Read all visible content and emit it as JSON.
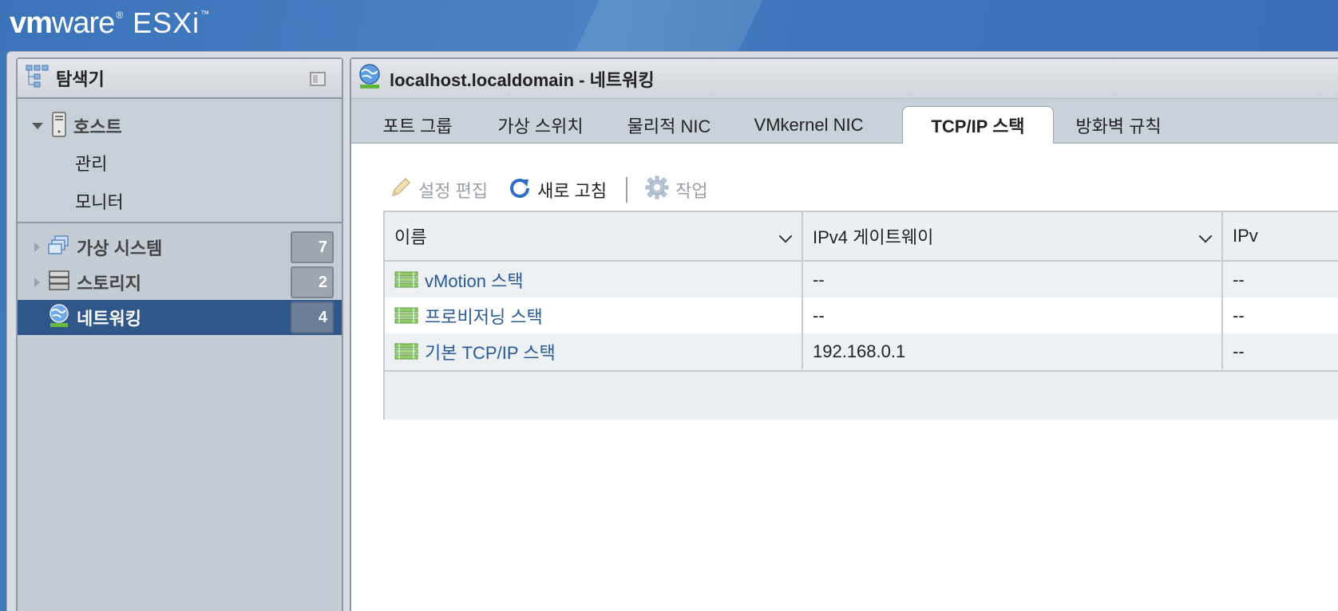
{
  "brand": {
    "vm": "vm",
    "ware": "ware",
    "reg": "®",
    "esxi": "ESXi",
    "tm": "™"
  },
  "navigator": {
    "title": "탐색기",
    "host": {
      "label": "호스트",
      "children": [
        "관리",
        "모니터"
      ]
    },
    "items": [
      {
        "label": "가상 시스템",
        "count": "7"
      },
      {
        "label": "스토리지",
        "count": "2"
      },
      {
        "label": "네트워킹",
        "count": "4",
        "selected": true
      }
    ]
  },
  "main": {
    "title": "localhost.localdomain - 네트워킹",
    "tabs": [
      {
        "label": "포트 그룹"
      },
      {
        "label": "가상 스위치"
      },
      {
        "label": "물리적 NIC"
      },
      {
        "label": "VMkernel NIC"
      },
      {
        "label": "TCP/IP 스택",
        "active": true
      },
      {
        "label": "방화벽 규칙"
      }
    ],
    "toolbar": {
      "edit_label": "설정 편집",
      "refresh_label": "새로 고침",
      "actions_label": "작업"
    },
    "table": {
      "columns": [
        "이름",
        "IPv4 게이트웨이",
        "IPv"
      ],
      "rows": [
        {
          "name": "vMotion 스택",
          "gateway": "--",
          "third": "--"
        },
        {
          "name": "프로비저닝 스택",
          "gateway": "--",
          "third": "--"
        },
        {
          "name": "기본 TCP/IP 스택",
          "gateway": "192.168.0.1",
          "third": "--"
        }
      ]
    }
  },
  "colors": {
    "selected_nav": "#30578a",
    "link": "#2a5a95",
    "header_blue": "#3f77bb"
  }
}
